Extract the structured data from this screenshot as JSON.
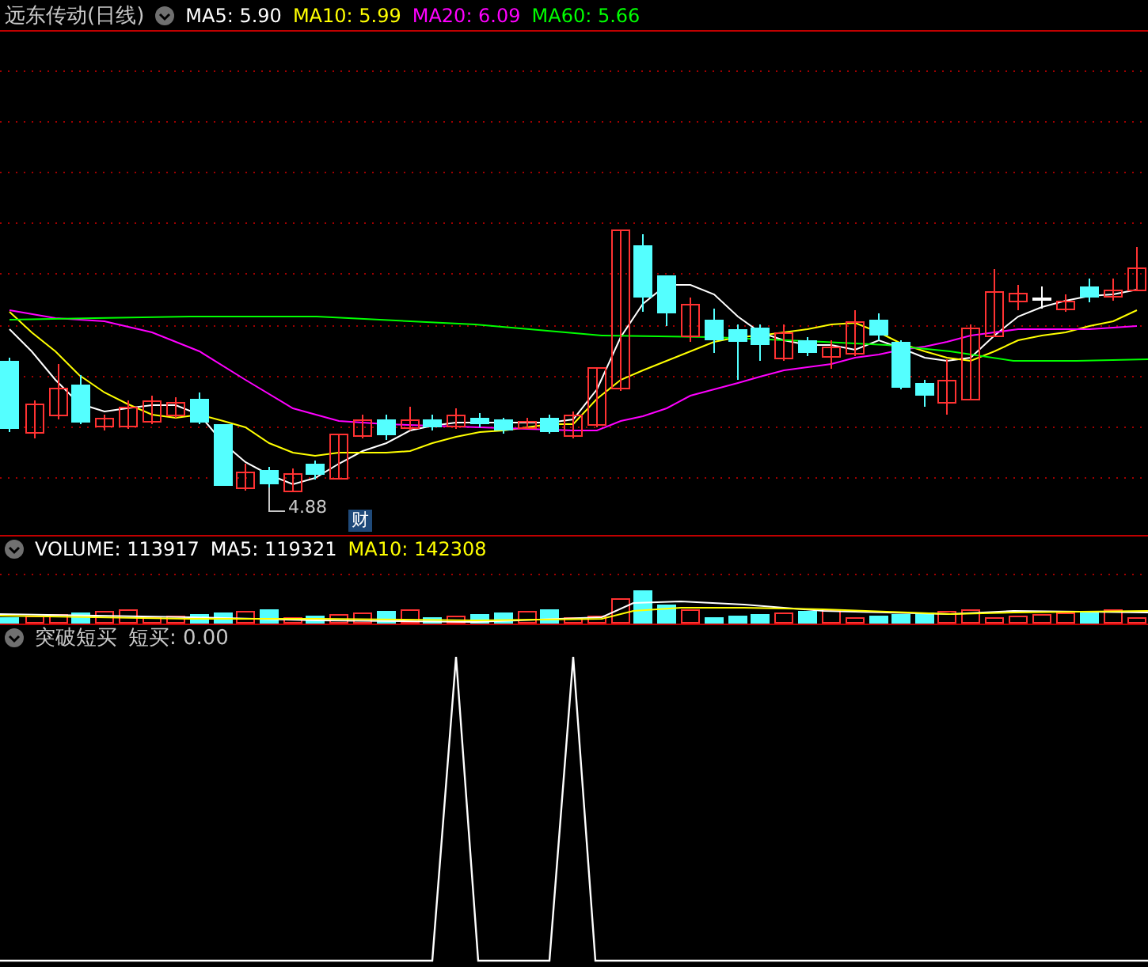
{
  "main_panel": {
    "title": "远东传动(日线)",
    "indicators": [
      {
        "label": "MA5: 5.90",
        "color": "#ffffff"
      },
      {
        "label": "MA10: 5.99",
        "color": "#ffff00"
      },
      {
        "label": "MA20: 6.09",
        "color": "#ff00ff"
      },
      {
        "label": "MA60: 5.66",
        "color": "#00ff00"
      }
    ],
    "low_marker": "4.88",
    "badge": "财"
  },
  "volume_panel": {
    "indicators": [
      {
        "label": "VOLUME: 113917",
        "color": "#ffffff"
      },
      {
        "label": "MA5: 119321",
        "color": "#ffffff"
      },
      {
        "label": "MA10: 142308",
        "color": "#ffff00"
      }
    ]
  },
  "signal_panel": {
    "title": "突破短买",
    "reading": "短买: 0.00"
  }
}
